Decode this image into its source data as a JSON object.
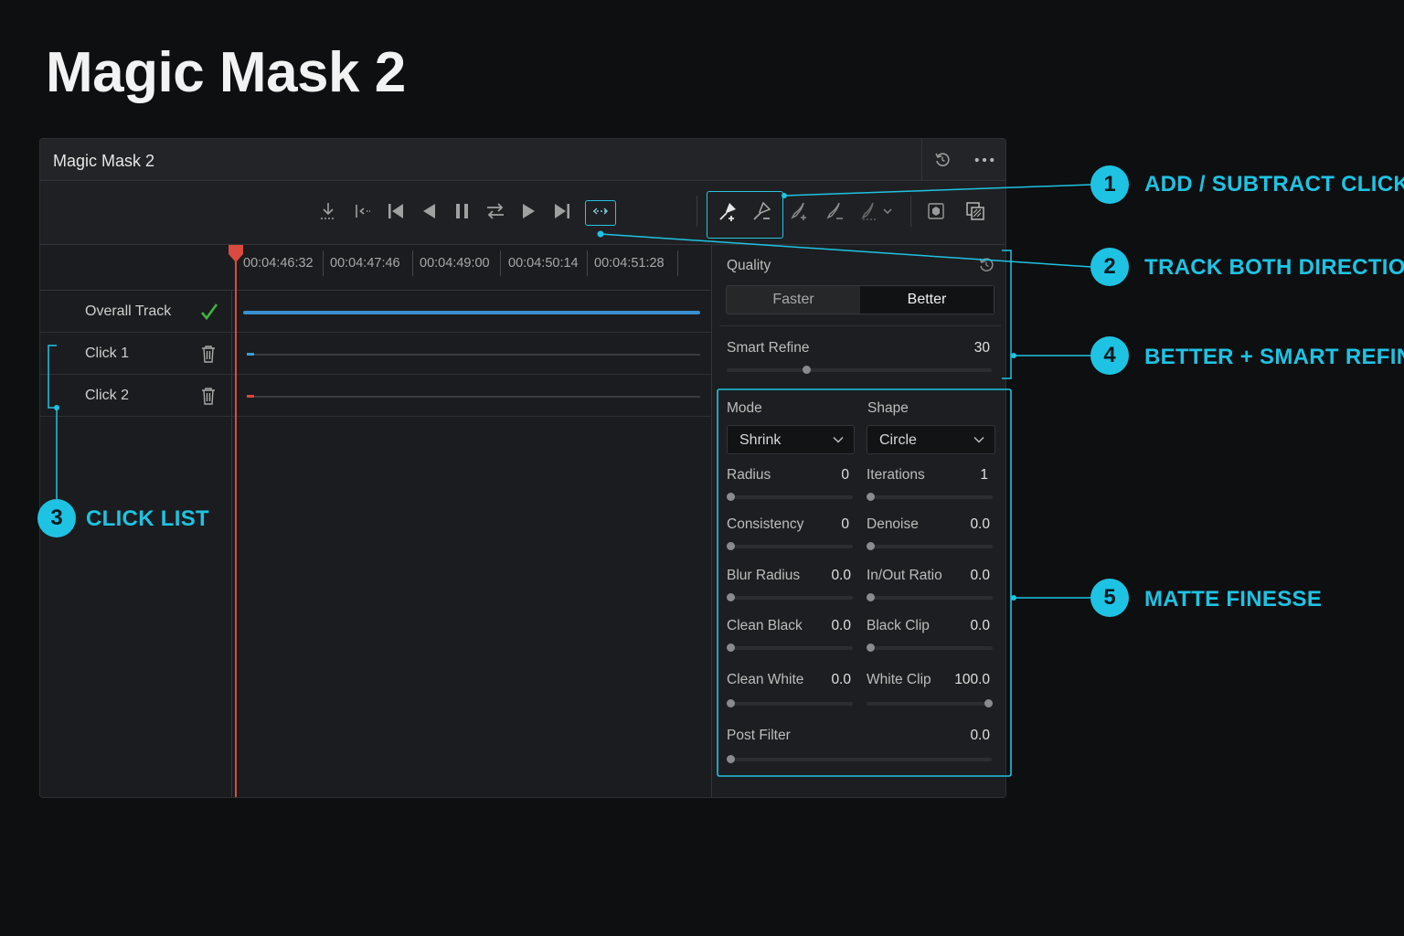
{
  "page_title": "Magic Mask 2",
  "panel": {
    "title": "Magic Mask 2",
    "header_icons": [
      "reset-icon",
      "more-options-icon"
    ]
  },
  "toolbar": {
    "transport_icons": [
      "track-in-icon",
      "go-to-mark-icon",
      "skip-to-start-icon",
      "track-backward-icon",
      "pause-icon",
      "track-both-directions-icon",
      "track-forward-icon",
      "skip-to-end-icon",
      "track-range-icon"
    ],
    "tool_icons": [
      "add-click-icon",
      "subtract-click-icon",
      "add-stroke-icon",
      "subtract-stroke-icon",
      "brush-dropdown-icon",
      "mask-overlay-icon",
      "matte-view-icon"
    ]
  },
  "timeline": {
    "timecodes": [
      "00:04:46:32",
      "00:04:47:46",
      "00:04:49:00",
      "00:04:50:14",
      "00:04:51:28"
    ],
    "tracks": [
      {
        "label": "Overall Track",
        "status": "tracked"
      },
      {
        "label": "Click 1",
        "color": "#3a9bd6"
      },
      {
        "label": "Click 2",
        "color": "#d9483b"
      }
    ]
  },
  "quality": {
    "label": "Quality",
    "options": [
      "Faster",
      "Better"
    ],
    "selected": "Better"
  },
  "smart_refine": {
    "label": "Smart Refine",
    "value": "30",
    "fraction": 0.3
  },
  "mode": {
    "label": "Mode",
    "selected": "Shrink"
  },
  "shape": {
    "label": "Shape",
    "selected": "Circle"
  },
  "params": [
    {
      "left": {
        "label": "Radius",
        "value": "0",
        "fraction": 0
      },
      "right": {
        "label": "Iterations",
        "value": "1",
        "fraction": 0
      }
    },
    {
      "left": {
        "label": "Consistency",
        "value": "0",
        "fraction": 0
      },
      "right": {
        "label": "Denoise",
        "value": "0.0",
        "fraction": 0
      }
    },
    {
      "left": {
        "label": "Blur Radius",
        "value": "0.0",
        "fraction": 0
      },
      "right": {
        "label": "In/Out Ratio",
        "value": "0.0",
        "fraction": 0
      }
    },
    {
      "left": {
        "label": "Clean Black",
        "value": "0.0",
        "fraction": 0
      },
      "right": {
        "label": "Black Clip",
        "value": "0.0",
        "fraction": 0
      }
    },
    {
      "left": {
        "label": "Clean White",
        "value": "0.0",
        "fraction": 0
      },
      "right": {
        "label": "White Clip",
        "value": "100.0",
        "fraction": 1
      }
    }
  ],
  "post_filter": {
    "label": "Post Filter",
    "value": "0.0",
    "fraction": 0
  },
  "callouts": [
    {
      "number": "1",
      "text": "ADD / SUBTRACT CLICKS"
    },
    {
      "number": "2",
      "text": "TRACK BOTH DIRECTIONS"
    },
    {
      "number": "3",
      "text": "CLICK LIST"
    },
    {
      "number": "4",
      "text": "BETTER + SMART REFINE"
    },
    {
      "number": "5",
      "text": "MATTE FINESSE"
    }
  ],
  "colors": {
    "accent": "#1ec3e3",
    "playhead": "#d94b3e",
    "track_ok": "#3fb33f",
    "track_bar": "#3a8fcf"
  }
}
